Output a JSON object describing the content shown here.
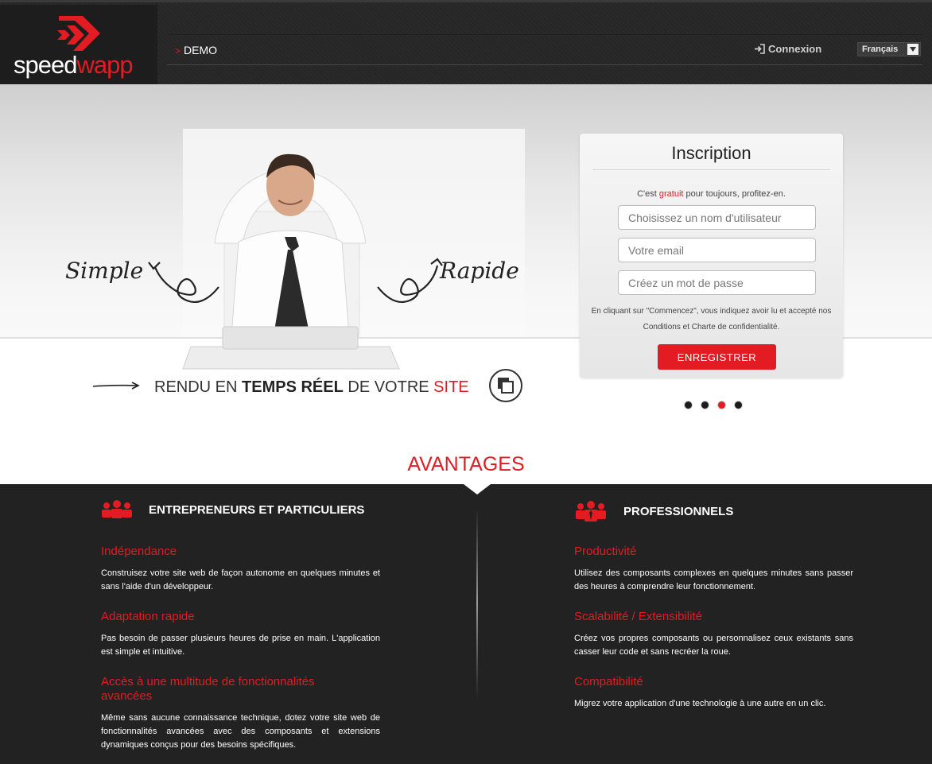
{
  "header": {
    "logo_left": "speed",
    "logo_right": "wapp",
    "nav_demo": "DEMO",
    "login_label": "Connexion",
    "language": "Français"
  },
  "hero": {
    "word_left": "Simple",
    "word_right": "Rapide",
    "tagline_1": "RENDU EN ",
    "tagline_bold": "TEMPS RÉEL",
    "tagline_2": " DE VOTRE ",
    "tagline_red": "SITE"
  },
  "signup": {
    "title": "Inscription",
    "lead_1": "C'est ",
    "lead_red": "gratuit",
    "lead_2": " pour toujours, profitez-en.",
    "username_placeholder": "Choisissez un nom d'utilisateur",
    "email_placeholder": "Votre email",
    "password_placeholder": "Créez un mot de passe",
    "terms": "En cliquant sur \"Commencez\", vous indiquez avoir lu et accepté nos Conditions et Charte de confidentialité.",
    "submit_label": "ENREGISTRER"
  },
  "carousel": {
    "count": 4,
    "active_index": 2
  },
  "advantages": {
    "title": "AVANTAGES",
    "left": {
      "heading": "ENTREPRENEURS ET PARTICULIERS",
      "items": [
        {
          "title": "Indépendance",
          "text": "Construisez votre site web de façon autonome en quelques minutes et sans l'aide d'un développeur."
        },
        {
          "title": "Adaptation rapide",
          "text": "Pas besoin de passer plusieurs heures de prise en main. L'application est simple et intuitive."
        },
        {
          "title": "Accès à une multitude de fonctionnalités avancées",
          "text": "Même sans aucune connaissance technique, dotez votre site web de fonctionnalités avancées avec des composants et extensions dynamiques conçus pour des besoins spécifiques."
        }
      ]
    },
    "right": {
      "heading": "PROFESSIONNELS",
      "items": [
        {
          "title": "Productivité",
          "text": "Utilisez des composants complexes en quelques minutes sans passer des heures à comprendre leur fonctionnement."
        },
        {
          "title": "Scalabilité / Extensibilité",
          "text": "Créez vos propres composants ou personnalisez ceux existants sans casser leur code et sans recréer la roue."
        },
        {
          "title": "Compatibilité",
          "text": "Migrez votre application d'une technologie à une autre en un clic."
        }
      ]
    }
  },
  "colors": {
    "accent": "#e31b23",
    "dark_bg": "#222222",
    "header_bg": "#2a2a2a"
  }
}
